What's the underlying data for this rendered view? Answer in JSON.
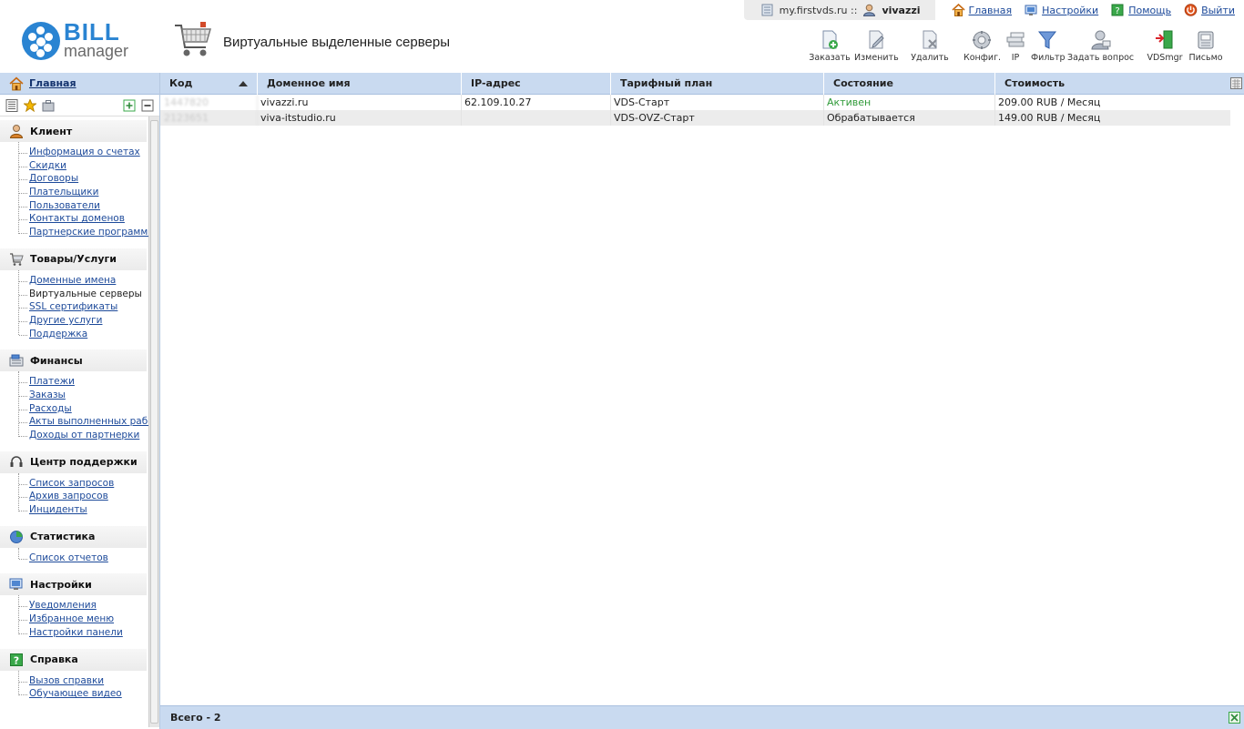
{
  "header": {
    "logo_bill": "BILL",
    "logo_manager": "manager",
    "page_title": "Виртуальные выделенные серверы",
    "site": "my.firstvds.ru ::",
    "user": "vivazzi",
    "links": [
      {
        "label": "Главная",
        "icon": "home-icon"
      },
      {
        "label": "Настройки",
        "icon": "settings-icon"
      },
      {
        "label": "Помощь",
        "icon": "help-icon"
      },
      {
        "label": "Выйти",
        "icon": "power-icon"
      }
    ]
  },
  "toolbar": [
    {
      "label": "Заказать",
      "icon": "order-add-icon"
    },
    {
      "label": "Изменить",
      "icon": "edit-icon"
    },
    {
      "label": "Удалить",
      "icon": "delete-icon"
    },
    {
      "label": "Конфиг.",
      "icon": "config-icon"
    },
    {
      "label": "IP",
      "icon": "ip-icon"
    },
    {
      "label": "Фильтр",
      "icon": "filter-icon"
    },
    {
      "label": "Задать вопрос",
      "icon": "ask-question-icon"
    },
    {
      "label": "VDSmgr",
      "icon": "vdsmgr-icon"
    },
    {
      "label": "Письмо",
      "icon": "letter-icon"
    }
  ],
  "sidebar": {
    "home_label": "Главная",
    "groups": [
      {
        "title": "Клиент",
        "icon": "client-icon",
        "items": [
          "Информация о счетах",
          "Скидки",
          "Договоры",
          "Плательщики",
          "Пользователи",
          "Контакты доменов",
          "Партнерские программы"
        ]
      },
      {
        "title": "Товары/Услуги",
        "icon": "cart-icon",
        "items": [
          "Доменные имена",
          "Виртуальные серверы",
          "SSL сертификаты",
          "Другие услуги",
          "Поддержка"
        ]
      },
      {
        "title": "Финансы",
        "icon": "finance-icon",
        "items": [
          "Платежи",
          "Заказы",
          "Расходы",
          "Акты выполненных работ",
          "Доходы от партнерки"
        ]
      },
      {
        "title": "Центр поддержки",
        "icon": "headset-icon",
        "items": [
          "Список запросов",
          "Архив запросов",
          "Инциденты"
        ]
      },
      {
        "title": "Статистика",
        "icon": "stats-icon",
        "items": [
          "Список отчетов"
        ]
      },
      {
        "title": "Настройки",
        "icon": "settings-icon",
        "items": [
          "Уведомления",
          "Избранное меню",
          "Настройки панели"
        ]
      },
      {
        "title": "Справка",
        "icon": "help-icon",
        "items": [
          "Вызов справки",
          "Обучающее видео"
        ]
      }
    ],
    "active_item": "Виртуальные серверы"
  },
  "table": {
    "columns": [
      "Код",
      "Доменное имя",
      "IP-адрес",
      "Тарифный план",
      "Состояние",
      "Стоимость"
    ],
    "rows": [
      {
        "code": "1447820",
        "domain": "vivazzi.ru",
        "ip": "62.109.10.27",
        "plan": "VDS-Старт",
        "status": "Активен",
        "cost": "209.00 RUB / Месяц"
      },
      {
        "code": "2123651",
        "domain": "viva-itstudio.ru",
        "ip": "",
        "plan": "VDS-OVZ-Старт",
        "status": "Обрабатывается",
        "cost": "149.00 RUB / Месяц"
      }
    ],
    "footer_total": "Всего - 2"
  },
  "colors": {
    "header_blue": "#c9daf0",
    "link_blue": "#1d4a9a",
    "status_active": "#2f9a38",
    "logo_blue": "#2a84d2"
  }
}
